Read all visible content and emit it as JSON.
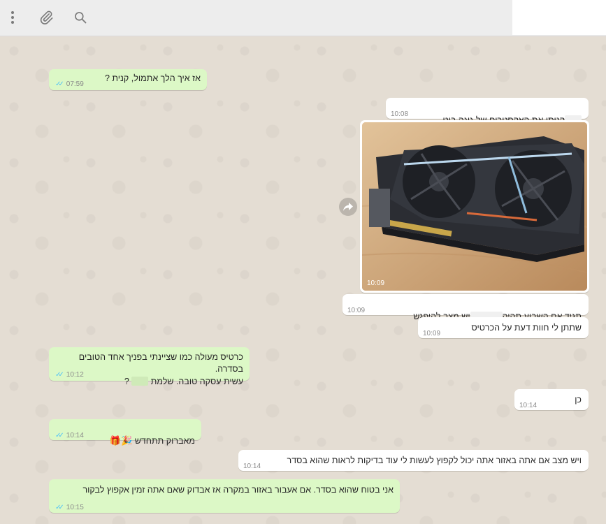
{
  "header": {
    "menu_icon": "more-vertical-icon",
    "attach_icon": "paperclip-icon",
    "search_icon": "search-icon"
  },
  "colors": {
    "outgoing_bubble": "#dcf8c6",
    "incoming_bubble": "#ffffff",
    "read_ticks": "#4fc3f7",
    "chat_background": "#e4ddd3"
  },
  "messages": [
    {
      "dir": "out",
      "text": "אז איך הלך אתמול, קנית ?",
      "time": "07:59"
    },
    {
      "dir": "in",
      "text": "קניתי את האקסטרים של גיגה ביט",
      "time": "10:08"
    },
    {
      "dir": "in",
      "type": "image",
      "image_desc": "graphics-card-photo",
      "time": "10:09"
    },
    {
      "dir": "in",
      "text_a": "תגיד אם השבוע תהיה",
      "text_b": "יש מצב להיפגש",
      "time": "10:09"
    },
    {
      "dir": "in",
      "text": "שתתן לי חוות דעת על הכרטיס",
      "time": "10:09"
    },
    {
      "dir": "out",
      "line1": "כרטיס מעולה כמו שציינתי בפניך אחד הטובים בסדרה.",
      "line2": "עשית עסקה טובה. שלמת",
      "line2_end": "?",
      "time": "10:12"
    },
    {
      "dir": "in",
      "text": "כן",
      "time": "10:14"
    },
    {
      "dir": "out",
      "text": "מאברוק תתחדש",
      "emoji": "🎉🎁",
      "time": "10:14"
    },
    {
      "dir": "in",
      "text": "ויש מצב אם אתה באזור אתה יכול לקפוץ לעשות לי עוד בדיקות לראות שהוא בסדר",
      "time": "10:14"
    },
    {
      "dir": "out",
      "text": "אני בטוח שהוא בסדר. אם אעבור באזור במקרה אז אבדוק שאם אתה זמין אקפוץ לבקור",
      "time": "10:15"
    }
  ]
}
